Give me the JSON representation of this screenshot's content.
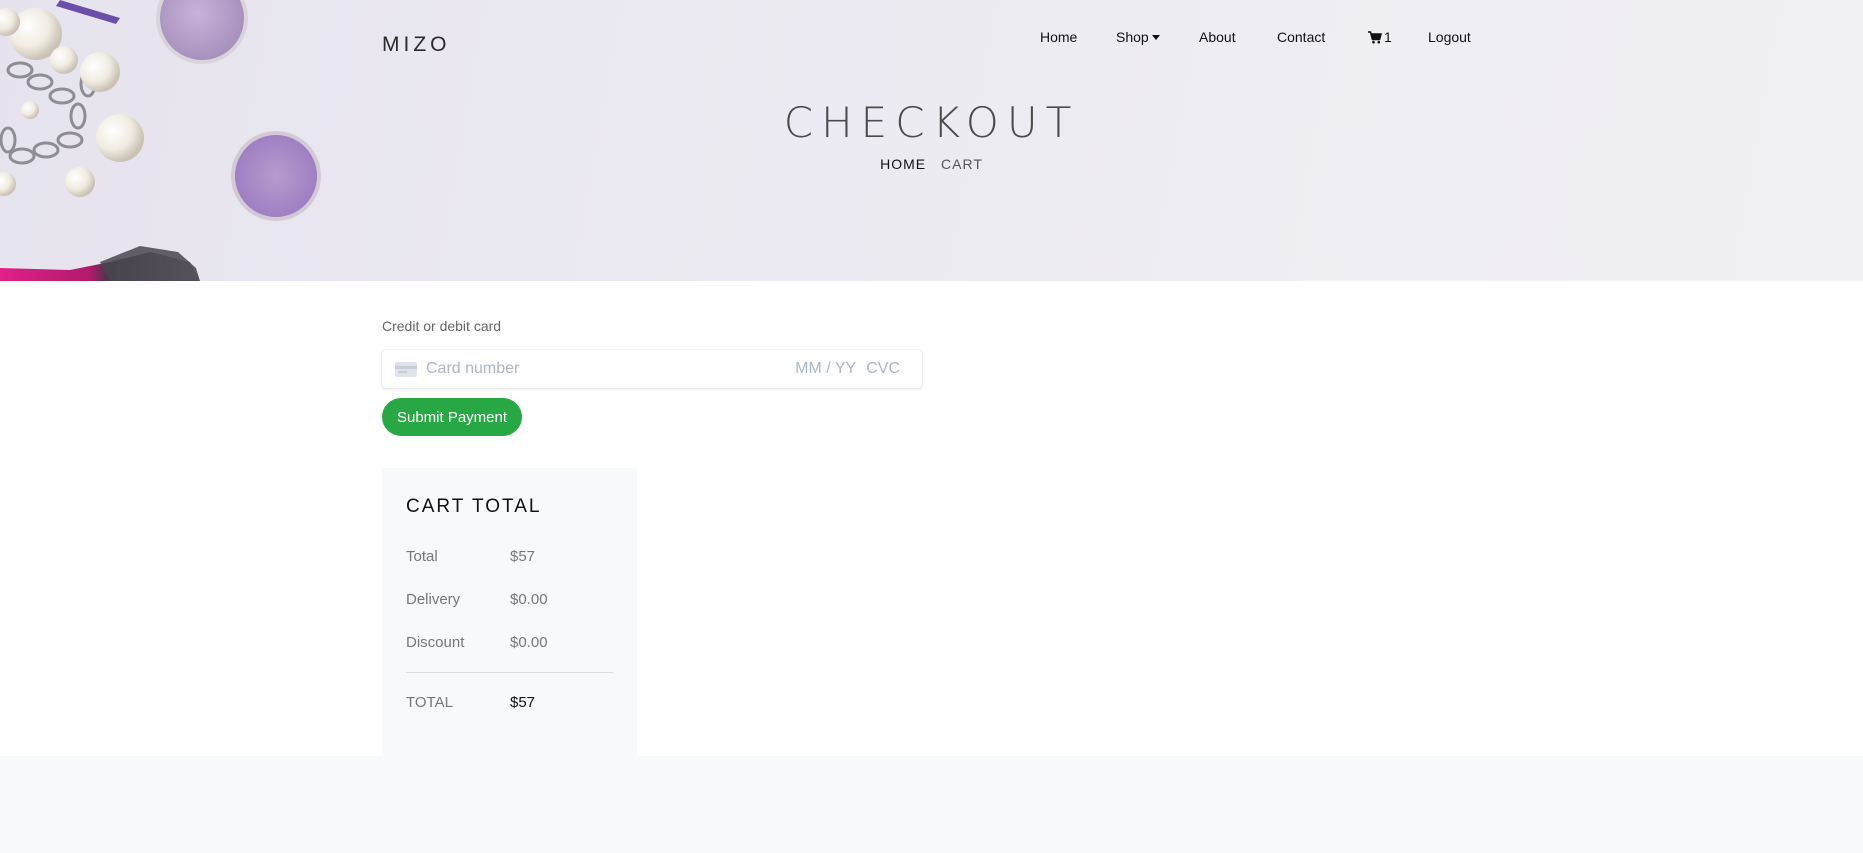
{
  "nav": {
    "brand": "MIZO",
    "items": [
      {
        "label": "Home"
      },
      {
        "label": "Shop"
      },
      {
        "label": "About"
      },
      {
        "label": "Contact"
      },
      {
        "label": "1",
        "icon": "cart-icon"
      },
      {
        "label": "Logout"
      }
    ]
  },
  "hero": {
    "title": "CHECKOUT",
    "breadcrumb": {
      "home": "HOME",
      "current": "CART"
    }
  },
  "payment": {
    "label": "Credit or debit card",
    "card_placeholder": "Card number",
    "expiry_placeholder": "MM / YY",
    "cvc_placeholder": "CVC",
    "submit_label": "Submit Payment",
    "submit_color": "#28a745"
  },
  "cart_total": {
    "heading": "CART TOTAL",
    "rows": [
      {
        "label": "Total",
        "value": "$57"
      },
      {
        "label": "Delivery",
        "value": "$0.00"
      },
      {
        "label": "Discount",
        "value": "$0.00"
      }
    ],
    "grand_total": {
      "label": "TOTAL",
      "value": "$57"
    }
  }
}
